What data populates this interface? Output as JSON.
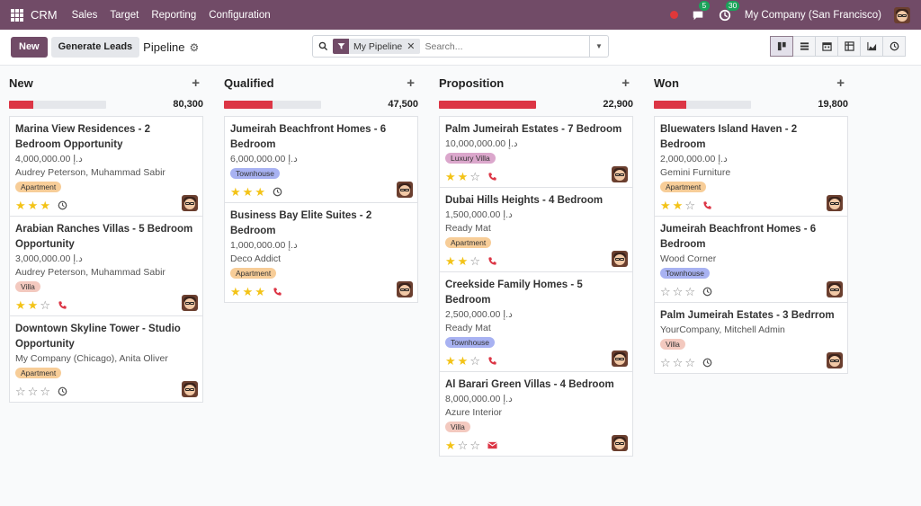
{
  "navbar": {
    "brand": "CRM",
    "menu": [
      "Sales",
      "Target",
      "Reporting",
      "Configuration"
    ],
    "messages_count": "5",
    "activities_count": "30",
    "company": "My Company (San Francisco)"
  },
  "control": {
    "new_label": "New",
    "generate_label": "Generate Leads",
    "title": "Pipeline",
    "facet_label": "My Pipeline",
    "search_placeholder": "Search..."
  },
  "colors": {
    "brand": "#714b67",
    "progress_red": "#dc3545",
    "star": "#f3c317"
  },
  "columns": [
    {
      "title": "New",
      "total": "80,300",
      "progress": 0.25,
      "cards": [
        {
          "title": "Marina View Residences - 2 Bedroom Opportunity",
          "amount": "4,000,000.00 د.إ",
          "partner": "Audrey Peterson, Muhammad Sabir",
          "tag": "Apartment",
          "tag_type": "apartment",
          "stars": 3,
          "activity": "clock-icon"
        },
        {
          "title": "Arabian Ranches Villas - 5 Bedroom Opportunity",
          "amount": "3,000,000.00 د.إ",
          "partner": "Audrey Peterson, Muhammad Sabir",
          "tag": "Villa",
          "tag_type": "villa",
          "stars": 2,
          "activity": "phone-icon"
        },
        {
          "title": "Downtown Skyline Tower - Studio Opportunity",
          "amount": "",
          "partner": "My Company (Chicago), Anita Oliver",
          "tag": "Apartment",
          "tag_type": "apartment",
          "stars": 0,
          "activity": "clock-icon"
        }
      ]
    },
    {
      "title": "Qualified",
      "total": "47,500",
      "progress": 0.5,
      "cards": [
        {
          "title": "Jumeirah Beachfront Homes - 6 Bedroom",
          "amount": "6,000,000.00 د.إ",
          "partner": "",
          "tag": "Townhouse",
          "tag_type": "townhouse",
          "stars": 3,
          "activity": "clock-icon"
        },
        {
          "title": "Business Bay Elite Suites - 2 Bedroom",
          "amount": "1,000,000.00 د.إ",
          "partner": "Deco Addict",
          "tag": "Apartment",
          "tag_type": "apartment",
          "stars": 3,
          "activity": "phone-icon"
        }
      ]
    },
    {
      "title": "Proposition",
      "total": "22,900",
      "progress": 1.0,
      "cards": [
        {
          "title": "Palm Jumeirah Estates - 7 Bedroom",
          "amount": "10,000,000.00 د.إ",
          "partner": "",
          "tag": "Luxury Villa",
          "tag_type": "luxury",
          "stars": 2,
          "activity": "phone-icon"
        },
        {
          "title": "Dubai Hills Heights - 4 Bedroom",
          "amount": "1,500,000.00 د.إ",
          "partner": "Ready Mat",
          "tag": "Apartment",
          "tag_type": "apartment",
          "stars": 2,
          "activity": "phone-icon"
        },
        {
          "title": "Creekside Family Homes - 5 Bedroom",
          "amount": "2,500,000.00 د.إ",
          "partner": "Ready Mat",
          "tag": "Townhouse",
          "tag_type": "townhouse",
          "stars": 2,
          "activity": "phone-icon"
        },
        {
          "title": "Al Barari Green Villas - 4 Bedroom",
          "amount": "8,000,000.00 د.إ",
          "partner": "Azure Interior",
          "tag": "Villa",
          "tag_type": "villa",
          "stars": 1,
          "activity": "email-icon"
        }
      ]
    },
    {
      "title": "Won",
      "total": "19,800",
      "progress": 0.33,
      "cards": [
        {
          "title": "Bluewaters Island Haven - 2 Bedroom",
          "amount": "2,000,000.00 د.إ",
          "partner": "Gemini Furniture",
          "tag": "Apartment",
          "tag_type": "apartment",
          "stars": 2,
          "activity": "phone-icon"
        },
        {
          "title": "Jumeirah Beachfront Homes - 6 Bedroom",
          "amount": "",
          "partner": "Wood Corner",
          "tag": "Townhouse",
          "tag_type": "townhouse",
          "stars": 0,
          "activity": "clock-icon"
        },
        {
          "title": "Palm Jumeirah Estates - 3 Bedrrom",
          "amount": "",
          "partner": "YourCompany, Mitchell Admin",
          "tag": "Villa",
          "tag_type": "villa",
          "stars": 0,
          "activity": "clock-icon"
        }
      ]
    }
  ]
}
